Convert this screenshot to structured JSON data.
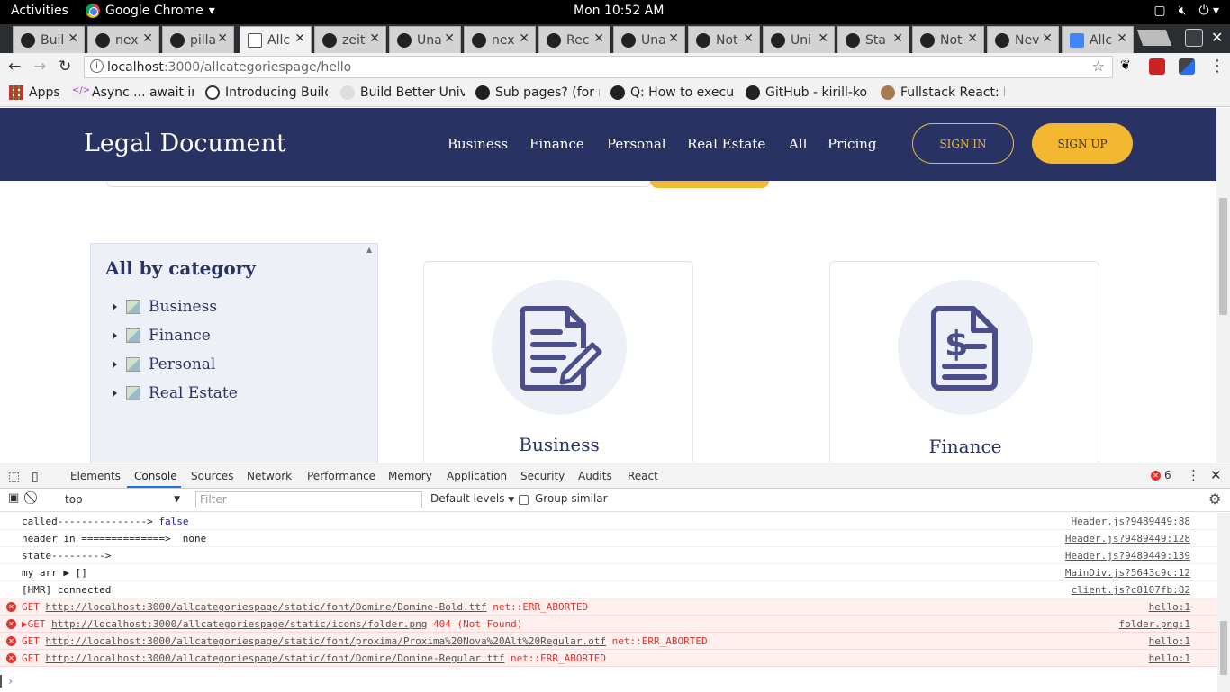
{
  "topbar": {
    "activities": "Activities",
    "app_name": "Google Chrome",
    "clock": "Mon 10:52 AM"
  },
  "tabs": [
    {
      "title": "Buil",
      "icon": "github-icon"
    },
    {
      "title": "nex",
      "icon": "github-icon"
    },
    {
      "title": "pilla",
      "icon": "github-icon"
    },
    {
      "title": "Allc",
      "icon": "page-icon",
      "active": true
    },
    {
      "title": "zeit",
      "icon": "github-icon"
    },
    {
      "title": "Una",
      "icon": "github-icon"
    },
    {
      "title": "nex",
      "icon": "github-icon"
    },
    {
      "title": "Rec",
      "icon": "github-icon"
    },
    {
      "title": "Una",
      "icon": "github-icon"
    },
    {
      "title": "Not",
      "icon": "github-icon"
    },
    {
      "title": "Uni",
      "icon": "github-icon"
    },
    {
      "title": "Sta",
      "icon": "github-icon"
    },
    {
      "title": "Not",
      "icon": "github-icon"
    },
    {
      "title": "Nev",
      "icon": "github-icon"
    },
    {
      "title": "Allc",
      "icon": "google-docs-icon"
    }
  ],
  "omnibox": {
    "host": "localhost",
    "path": ":3000/allcategoriespage/hello"
  },
  "bookmarks": [
    {
      "label": "Apps",
      "icon": "apps-grid-icon"
    },
    {
      "label": "Async ... await in",
      "icon": "code-icon"
    },
    {
      "label": "Introducing Build",
      "icon": "spy-icon"
    },
    {
      "label": "Build Better Unive",
      "icon": "brush-icon"
    },
    {
      "label": "Sub pages? (for r",
      "icon": "github-icon"
    },
    {
      "label": "Q: How to execu",
      "icon": "github-icon"
    },
    {
      "label": "GitHub - kirill-ko",
      "icon": "github-icon"
    },
    {
      "label": "Fullstack React: I",
      "icon": "cookie-icon"
    }
  ],
  "site": {
    "logo": "Legal Document",
    "nav": [
      "Business",
      "Finance",
      "Personal",
      "Real Estate",
      "All",
      "Pricing"
    ],
    "signin": "SIGN IN",
    "signup": "SIGN UP",
    "accent": "#f4b731",
    "brand": "#293363"
  },
  "sidebar": {
    "title": "All by category",
    "items": [
      "Business",
      "Finance",
      "Personal",
      "Real Estate"
    ]
  },
  "cards": [
    {
      "title": "Business",
      "icon": "document-pen-icon"
    },
    {
      "title": "Finance",
      "icon": "document-dollar-icon"
    }
  ],
  "devtools": {
    "tabs": [
      "Elements",
      "Console",
      "Sources",
      "Network",
      "Performance",
      "Memory",
      "Application",
      "Security",
      "Audits",
      "React"
    ],
    "active_tab": "Console",
    "error_count": "6",
    "context": "top",
    "filter_placeholder": "Filter",
    "levels": "Default levels",
    "group_similar": "Group similar"
  },
  "console": [
    {
      "type": "log",
      "text": "called---------------> ",
      "value": "false",
      "source": "Header.js?9489449:88"
    },
    {
      "type": "log",
      "text": "header in ==============>  none",
      "source": "Header.js?9489449:128"
    },
    {
      "type": "log",
      "text": "state--------->",
      "source": "Header.js?9489449:139"
    },
    {
      "type": "log",
      "text": "my arr ▶ []",
      "source": "MainDiv.js?5643c9c:12"
    },
    {
      "type": "log",
      "text": "[HMR] connected",
      "source": "client.js?c8107fb:82"
    },
    {
      "type": "error",
      "method": "GET",
      "url": "http://localhost:3000/allcategoriespage/static/font/Domine/Domine-Bold.ttf",
      "suffix": " net::ERR_ABORTED",
      "source": "hello:1"
    },
    {
      "type": "error",
      "method": "▶GET",
      "url": "http://localhost:3000/allcategoriespage/static/icons/folder.png",
      "suffix": " 404 (Not Found)",
      "source": "folder.png:1"
    },
    {
      "type": "error",
      "method": "GET",
      "url": "http://localhost:3000/allcategoriespage/static/font/proxima/Proxima%20Nova%20Alt%20Regular.otf",
      "suffix": " net::ERR_ABORTED",
      "source": "hello:1"
    },
    {
      "type": "error",
      "method": "GET",
      "url": "http://localhost:3000/allcategoriespage/static/font/Domine/Domine-Regular.ttf",
      "suffix": " net::ERR_ABORTED",
      "source": "hello:1"
    }
  ]
}
